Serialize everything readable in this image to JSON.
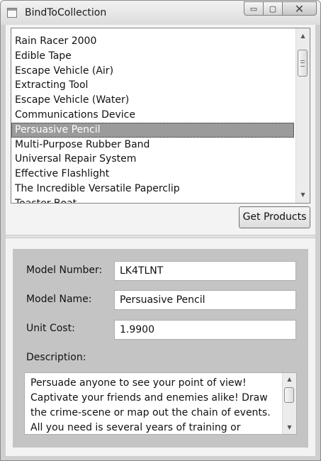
{
  "window": {
    "title": "BindToCollection",
    "controls": {
      "minimize": "▭",
      "maximize": "▢",
      "close": "✕"
    }
  },
  "products": {
    "items": [
      "Rain Racer 2000",
      "Edible Tape",
      "Escape Vehicle (Air)",
      "Extracting Tool",
      "Escape Vehicle (Water)",
      "Communications Device",
      "Persuasive Pencil",
      "Multi-Purpose Rubber Band",
      "Universal Repair System",
      "Effective Flashlight",
      "The Incredible Versatile Paperclip",
      "Toaster Boat"
    ],
    "selected_index": 6,
    "scroll_up": "▲",
    "scroll_down": "▼"
  },
  "toolbar": {
    "get_products_label": "Get Products"
  },
  "details": {
    "model_number_label": "Model Number:",
    "model_number_value": "LK4TLNT",
    "model_name_label": "Model Name:",
    "model_name_value": "Persuasive Pencil",
    "unit_cost_label": "Unit Cost:",
    "unit_cost_value": "1.9900",
    "description_label": "Description:",
    "description_value": "Persuade anyone to see your point of view!\nCaptivate your friends and enemies alike!  Draw the crime-scene or map out the chain of events.\nAll you need is several years of training or"
  }
}
